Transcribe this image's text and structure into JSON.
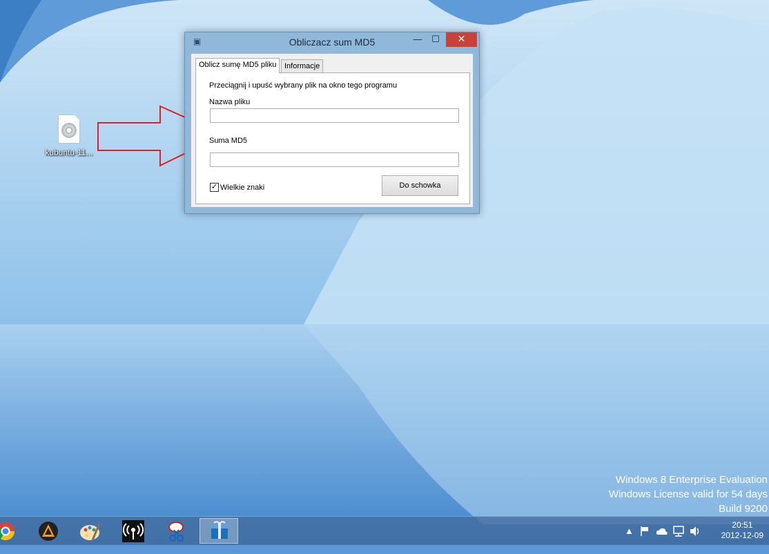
{
  "window": {
    "title": "Obliczacz sum MD5",
    "minimize_glyph": "—",
    "maximize_glyph": "☐",
    "close_glyph": "✕",
    "tabs": [
      {
        "label": "Oblicz sumę MD5 pliku",
        "active": true
      },
      {
        "label": "Informacje",
        "active": false
      }
    ],
    "instruction": "Przeciągnij i upuść wybrany plik na okno tego programu",
    "filename_label": "Nazwa pliku",
    "filename_value": "",
    "md5_label": "Suma MD5",
    "md5_value": "",
    "uppercase_checkbox": {
      "label": "Wielkie znaki",
      "checked": true
    },
    "copy_button": "Do schowka"
  },
  "desktop": {
    "icons": [
      {
        "label": "kubuntu-11...",
        "icon": "disc-image-file-icon"
      }
    ]
  },
  "watermark": {
    "line1": "Windows 8 Enterprise Evaluation",
    "line2": "Windows License valid for 54 days",
    "line3": "Build 9200"
  },
  "taskbar": {
    "pinned": [
      {
        "name": "chrome-icon"
      },
      {
        "name": "vlc-icon"
      },
      {
        "name": "paint-icon"
      },
      {
        "name": "wireless-icon"
      },
      {
        "name": "snipping-tool-icon"
      },
      {
        "name": "md5-app-icon",
        "active": true
      }
    ],
    "tray": [
      "show-hidden-icons-icon",
      "action-center-flag-icon",
      "onedrive-cloud-icon",
      "network-icon",
      "volume-icon"
    ],
    "clock": {
      "time": "20:51",
      "date": "2012-12-09"
    }
  },
  "colors": {
    "accent_close": "#c7433a",
    "arrow_red": "#e02020",
    "window_frame": "#8fb8db"
  }
}
